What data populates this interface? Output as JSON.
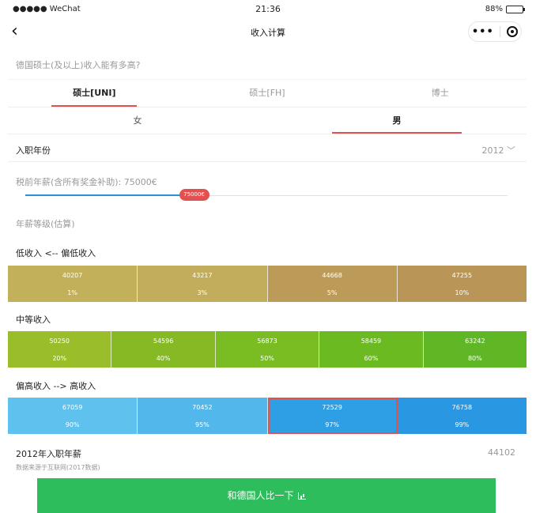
{
  "status_bar": {
    "carrier": "●●●●● WeChat",
    "time": "21:36",
    "battery": "88%",
    "battery_level": 0.88
  },
  "nav": {
    "title": "收入计算"
  },
  "question": "德国硕士(及以上)收入能有多高?",
  "degree_tabs": [
    {
      "label": "硕士[UNI]",
      "active": true
    },
    {
      "label": "硕士[FH]",
      "active": false
    },
    {
      "label": "博士",
      "active": false
    }
  ],
  "gender_tabs": [
    {
      "label": "女",
      "active": false
    },
    {
      "label": "男",
      "active": true
    }
  ],
  "entry_year": {
    "label": "入职年份",
    "value": "2012 ﹀"
  },
  "salary": {
    "label": "税前年薪(含所有奖金补助): 75000€",
    "thumb_label": "75000€",
    "slider_fraction": 0.35
  },
  "grade_label": "年薪等级(估算)",
  "sections": [
    {
      "label": "低收入 <-- 偏低收入",
      "cells": [
        {
          "value": "40207",
          "pct": "1%",
          "color": "#c2b15a"
        },
        {
          "value": "43217",
          "pct": "3%",
          "color": "#c1ad5c"
        },
        {
          "value": "44668",
          "pct": "5%",
          "color": "#bc9a58"
        },
        {
          "value": "47255",
          "pct": "10%",
          "color": "#b99657"
        }
      ]
    },
    {
      "label": "中等收入",
      "cells": [
        {
          "value": "50250",
          "pct": "20%",
          "color": "#9abe2a"
        },
        {
          "value": "54596",
          "pct": "40%",
          "color": "#86ba25"
        },
        {
          "value": "56873",
          "pct": "50%",
          "color": "#7abd22"
        },
        {
          "value": "58459",
          "pct": "60%",
          "color": "#6cba22"
        },
        {
          "value": "63242",
          "pct": "80%",
          "color": "#5fb726"
        }
      ]
    },
    {
      "label": "偏高收入 --> 高收入",
      "cells": [
        {
          "value": "67059",
          "pct": "90%",
          "color": "#5ec1ee"
        },
        {
          "value": "70452",
          "pct": "95%",
          "color": "#52b8ec"
        },
        {
          "value": "72529",
          "pct": "97%",
          "color": "#2f9fe5",
          "highlight": true
        },
        {
          "value": "76758",
          "pct": "99%",
          "color": "#2a97e2"
        }
      ]
    }
  ],
  "result": {
    "title": "2012年入职年薪",
    "source": "数据来源于互联网(2017数据)",
    "value": "44102"
  },
  "compare_button": {
    "label": "和德国人比一下"
  },
  "colors": {
    "accent_red": "#e25050",
    "slider_blue": "#2f8fd8",
    "button_green": "#2dbd5d"
  }
}
